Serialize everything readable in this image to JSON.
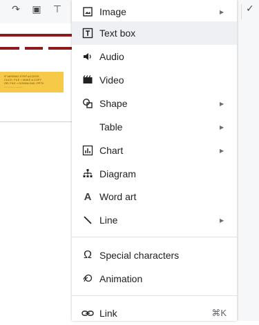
{
  "menu": {
    "items": [
      {
        "label": "Image",
        "icon": "image-icon",
        "submenu": true
      },
      {
        "label": "Text box",
        "icon": "textbox-icon",
        "submenu": false
      },
      {
        "label": "Audio",
        "icon": "audio-icon",
        "submenu": false
      },
      {
        "label": "Video",
        "icon": "video-icon",
        "submenu": false
      },
      {
        "label": "Shape",
        "icon": "shape-icon",
        "submenu": true
      },
      {
        "label": "Table",
        "icon": "",
        "submenu": true
      },
      {
        "label": "Chart",
        "icon": "chart-icon",
        "submenu": true
      },
      {
        "label": "Diagram",
        "icon": "diagram-icon",
        "submenu": false
      },
      {
        "label": "Word art",
        "icon": "word-art-icon",
        "submenu": false
      },
      {
        "label": "Line",
        "icon": "line-icon",
        "submenu": true
      },
      {
        "label": "Special characters",
        "icon": "omega-icon",
        "submenu": false
      },
      {
        "label": "Animation",
        "icon": "animation-icon",
        "submenu": false
      },
      {
        "label": "Link",
        "icon": "link-icon",
        "submenu": false,
        "shortcut": "⌘K"
      }
    ],
    "highlighted": "Text box"
  },
  "slide": {
    "note_lines": [
      "IF MISSING STEP ACCESS",
      "CLICK: FILE > MAKE A COPY",
      "OR: FILE > DOWNLOAD .PPTX",
      "........................"
    ]
  },
  "colors": {
    "accent": "#8e1b1b",
    "note": "#f7c948",
    "highlight": "#eef0f3"
  }
}
